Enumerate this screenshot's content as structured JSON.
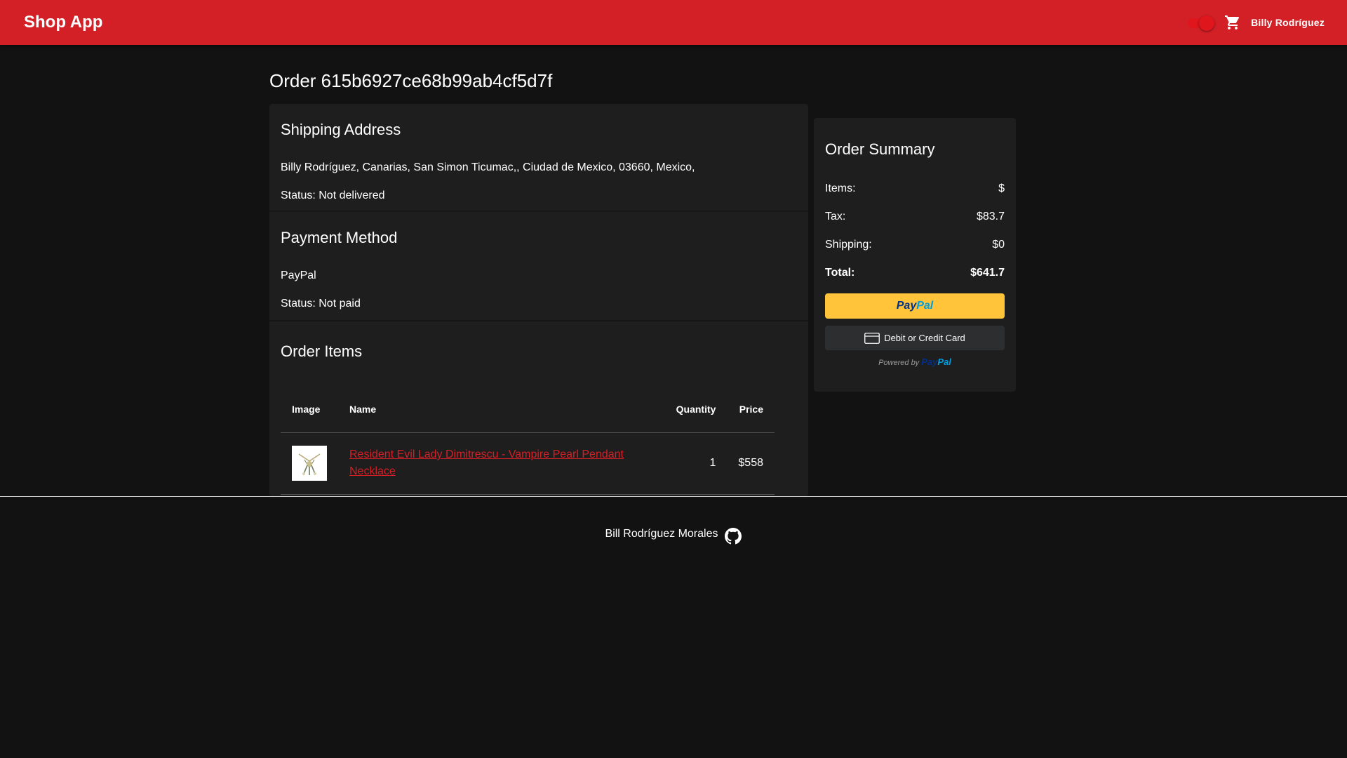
{
  "appbar": {
    "brand": "Shop App",
    "theme_toggle_on": true,
    "cart_icon": "cart-icon",
    "user_name": "Billy Rodríguez"
  },
  "order": {
    "title": "Order 615b6927ce68b99ab4cf5d7f"
  },
  "shipping": {
    "heading": "Shipping Address",
    "address": "Billy Rodríguez, Canarias, San Simon Ticumac,, Ciudad de Mexico, 03660, Mexico,",
    "status": "Status: Not delivered"
  },
  "payment": {
    "heading": "Payment Method",
    "method": "PayPal",
    "status": "Status: Not paid"
  },
  "items": {
    "heading": "Order Items",
    "columns": [
      "Image",
      "Name",
      "Quantity",
      "Price"
    ],
    "rows": [
      {
        "image_icon": "necklace-image",
        "name": "Resident Evil Lady Dimitrescu - Vampire Pearl Pendant Necklace",
        "quantity": "1",
        "price": "$558"
      }
    ]
  },
  "summary": {
    "heading": "Order Summary",
    "items_label": "Items:",
    "items_value": "$",
    "tax_label": "Tax:",
    "tax_value": "$83.7",
    "shipping_label": "Shipping:",
    "shipping_value": "$0",
    "total_label": "Total:",
    "total_value": "$641.7",
    "paypal_pay": "Pay",
    "paypal_pal": "Pal",
    "card_button": "Debit or Credit Card",
    "powered_by": "Powered by",
    "powered_pay": "Pay",
    "powered_pal": "Pal"
  },
  "footer": {
    "author": "Bill Rodríguez Morales",
    "github_icon": "github-icon"
  },
  "colors": {
    "primary": "#d32027",
    "background": "#121212",
    "card": "#1e1e1e",
    "paypal_yellow": "#ffc439"
  }
}
